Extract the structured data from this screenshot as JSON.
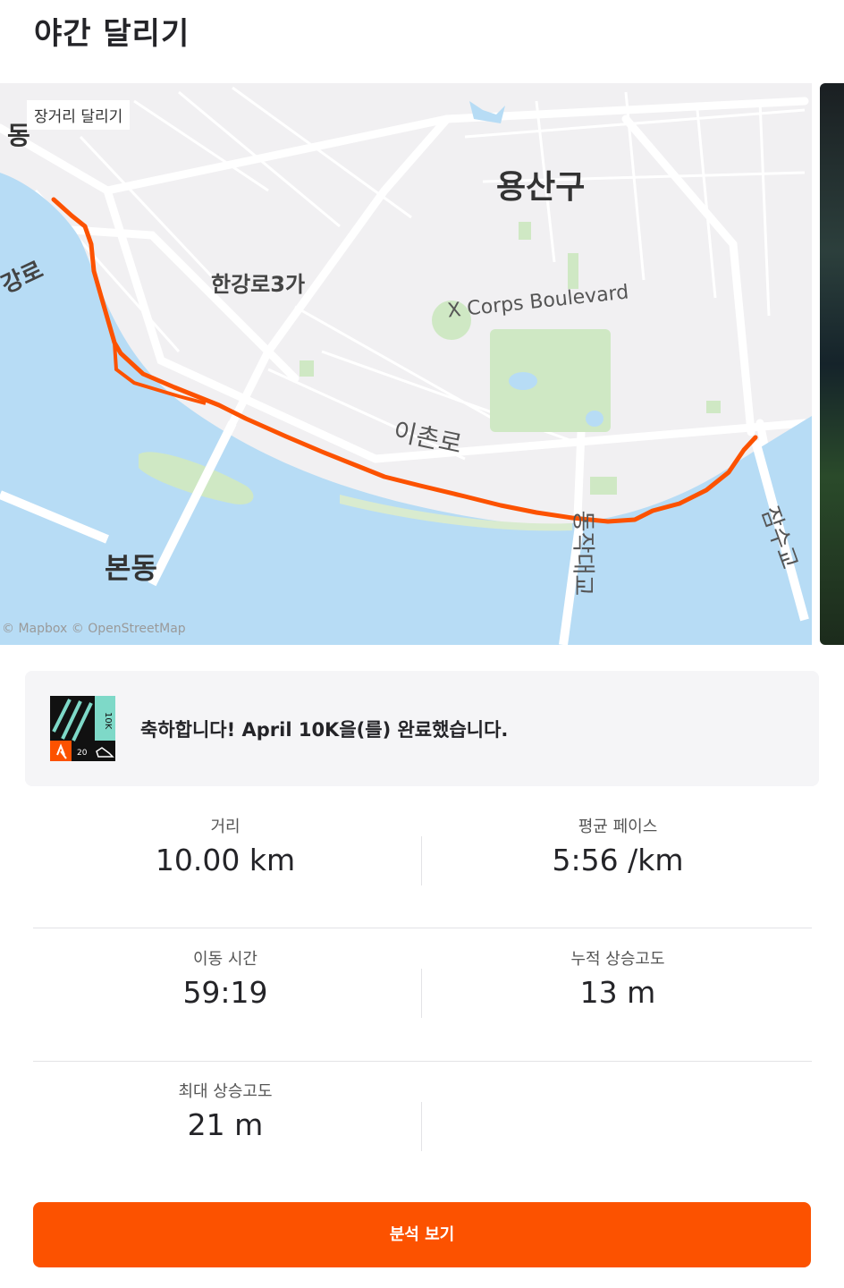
{
  "header": {
    "title": "야간 달리기"
  },
  "map": {
    "tag": "장거리 달리기",
    "labels": {
      "district_left": "동",
      "road_left": "강로",
      "district_main": "용산구",
      "hangangro": "한강로3가",
      "corps_blvd": "X Corps Boulevard",
      "ichonro": "이촌로",
      "bondong": "본동",
      "dongjak_bridge": "동작대교",
      "jamsu_bridge": "잠수교",
      "attribution": "© Mapbox © OpenStreetMap"
    },
    "colors": {
      "water": "#b7dcf5",
      "park": "#cfe8c4",
      "land": "#f1f0f2",
      "road": "#ffffff",
      "route": "#fc5200"
    }
  },
  "banner": {
    "text": "축하합니다! April 10K을(를) 완료했습니다.",
    "badge_label": "10K",
    "badge_colors": {
      "accent": "#7ed9c8",
      "dark": "#111111",
      "orange": "#fc5200"
    }
  },
  "stats": {
    "distance": {
      "label": "거리",
      "value": "10.00 km"
    },
    "pace": {
      "label": "평균 페이스",
      "value": "5:56 /km"
    },
    "moving_time": {
      "label": "이동 시간",
      "value": "59:19"
    },
    "elevation_gain": {
      "label": "누적 상승고도",
      "value": "13 m"
    },
    "max_elevation": {
      "label": "최대 상승고도",
      "value": "21 m"
    }
  },
  "cta": {
    "label": "분석 보기"
  }
}
